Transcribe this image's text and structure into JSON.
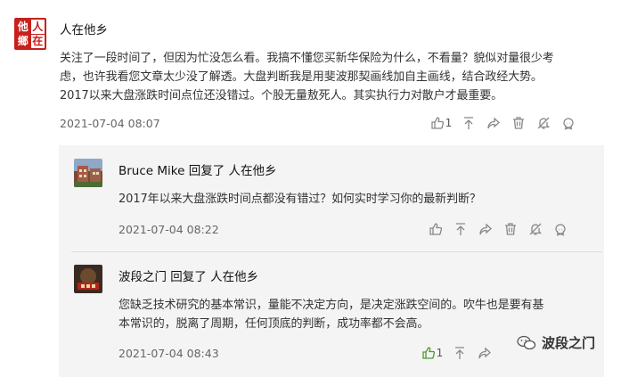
{
  "main_comment": {
    "avatar_chars": [
      "他",
      "人",
      "鄉",
      "在"
    ],
    "username": "人在他乡",
    "text_lines": [
      "关注了一段时间了，但因为忙没怎么看。我搞不懂您买新华保险为什么，不看量？貌似对量很少考",
      "虑，也许我看您文章太少没了解透。大盘判断我是用斐波那契画线加自主画线，结合政经大势。",
      "2017以来大盘涨跌时间点位还没错过。个股无量敖死人。其实执行力对散户才最重要。"
    ],
    "timestamp": "2021-07-04 08:07",
    "like_count": "1"
  },
  "replies": [
    {
      "username": "Bruce Mike",
      "reply_verb": "回复了",
      "reply_to": "人在他乡",
      "text_lines": [
        "2017年以来大盘涨跌时间点都没有错过？如何实时学习你的最新判断？"
      ],
      "timestamp": "2021-07-04 08:22",
      "like_count": ""
    },
    {
      "username": "波段之门",
      "reply_verb": "回复了",
      "reply_to": "人在他乡",
      "text_lines": [
        "您缺乏技术研究的基本常识，量能不决定方向，是决定涨跌空间的。吹牛也是要有基",
        "本常识的，脱离了周期，任何顶底的判断，成功率都不会高。"
      ],
      "timestamp": "2021-07-04 08:43",
      "like_count": "1"
    }
  ],
  "watermark": {
    "text": "波段之门",
    "icon": "wechat-icon"
  },
  "icons": [
    "thumbs-up-icon",
    "pin-top-icon",
    "share-icon",
    "trash-icon",
    "mute-icon",
    "skull-icon"
  ],
  "colors": {
    "reply_bg": "#f4f4f4",
    "liked_green": "#4a9a2c",
    "avatar_red": "#c8201c"
  }
}
